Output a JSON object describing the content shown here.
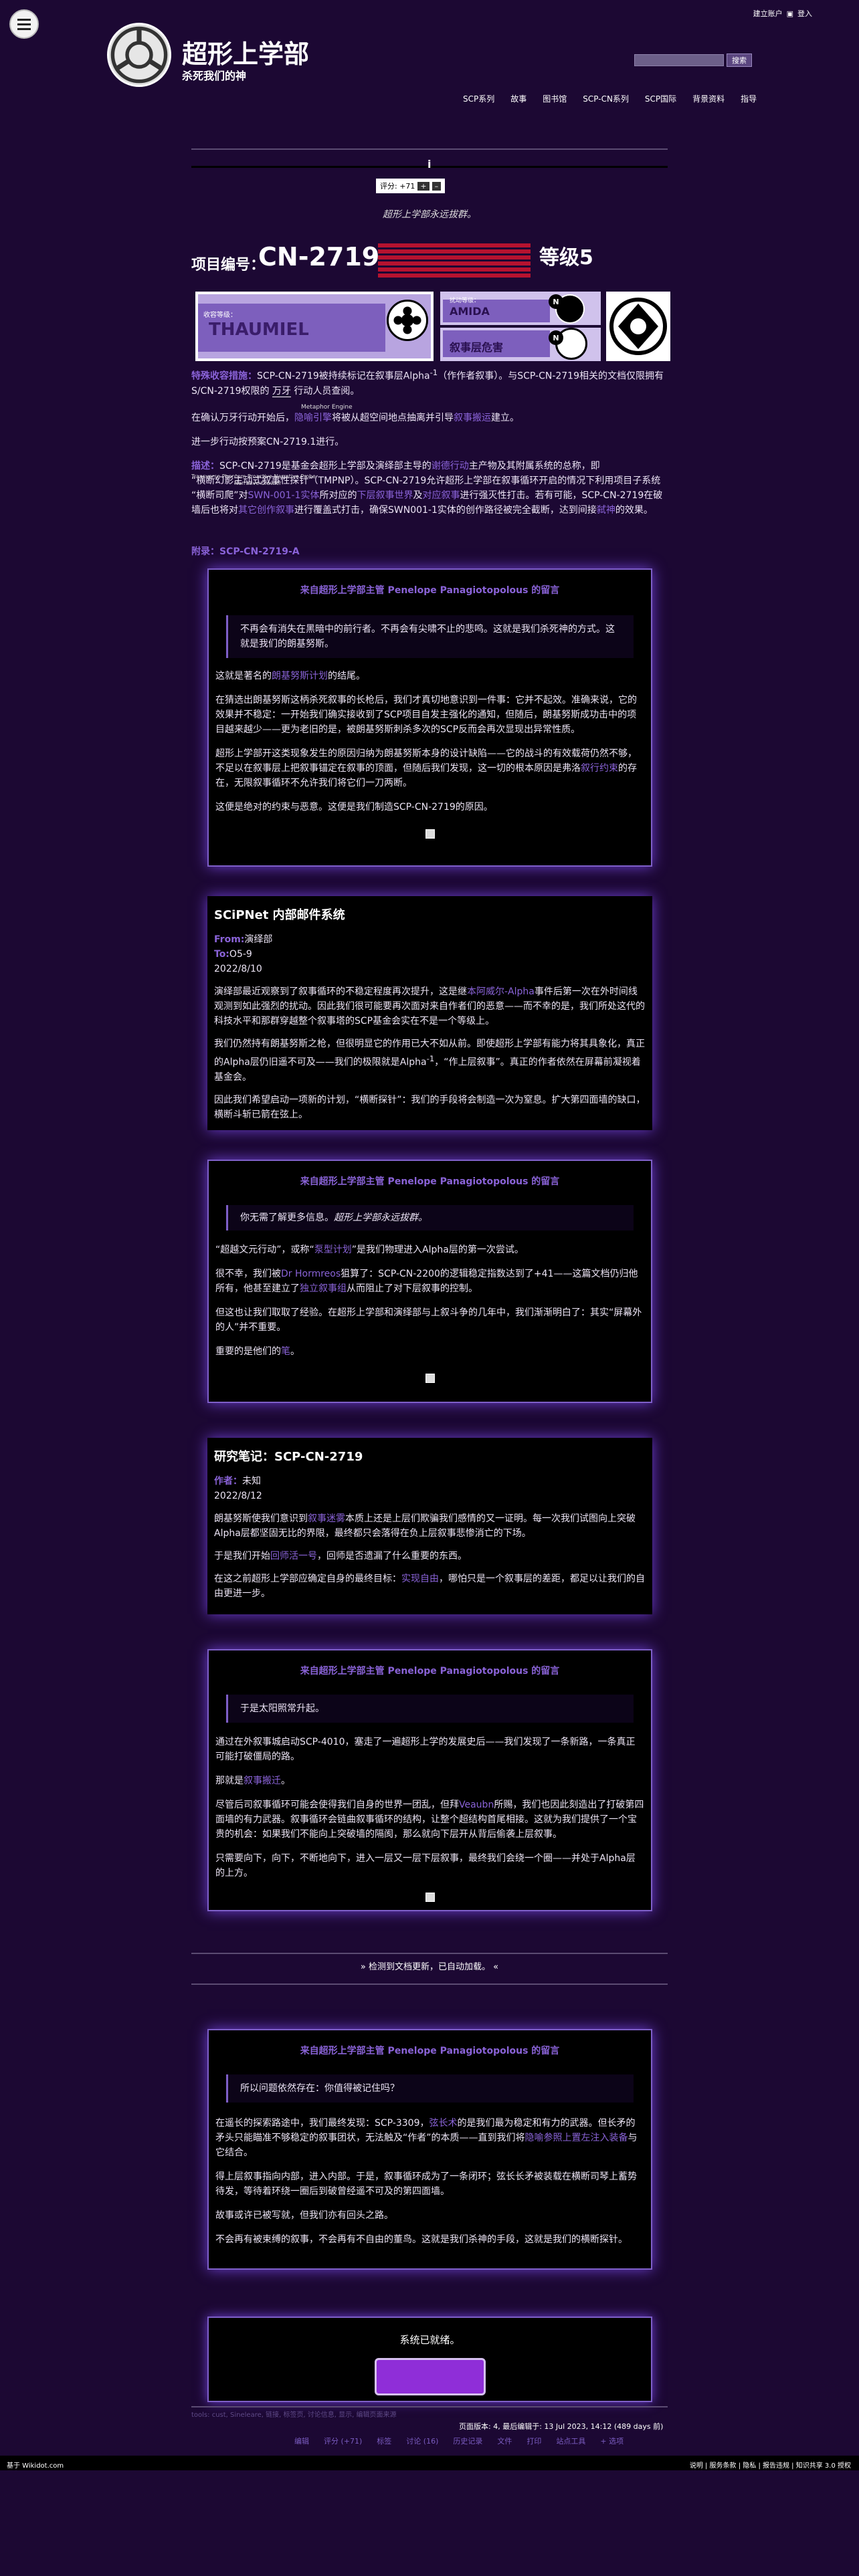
{
  "site": {
    "title": "超形上学部",
    "subtitle": "杀死我们的神",
    "account_create": "建立账户",
    "account_login": "登入",
    "search_button": "搜索"
  },
  "nav": [
    "SCP系列",
    "故事",
    "图书馆",
    "SCP-CN系列",
    "SCP国际",
    "背景资料",
    "指导"
  ],
  "rating": {
    "label": "评分: +71",
    "plus": "+",
    "minus": "–"
  },
  "motto": "超形上学部永远拔群。",
  "item": {
    "label": "项目编号：",
    "number": "CN-2719",
    "clearance": "等级5"
  },
  "classes": {
    "containment_label": "收容等级：",
    "containment": "THAUMIEL",
    "disruption_label": "扰动等级：",
    "disruption": "AMIDA",
    "risk": "叙事层危害",
    "badge": "N"
  },
  "paras": {
    "special_label": "特殊收容措施：",
    "special": "SCP-CN-2719被持续标记在叙事层Alpha",
    "special_sup": "-1",
    "special_2": "（作作者叙事）。与SCP-CN-2719相关的文档仅限拥有S/CN-2719权限的 ",
    "special_ruby": "万牙",
    "special_3": " 行动人员查阅。",
    "p2_a": "在确认万牙行动开始后，",
    "p2_ruby_top": "Metaphor Engine",
    "p2_link": "隐喻引擎",
    "p2_b": "将被从超空间地点抽离并引导",
    "p2_link2": "叙事搬运",
    "p2_c": "建立。",
    "p3": "进一步行动按预案CN-2719.1进行。",
    "desc_label": "描述：",
    "desc_a": "SCP-CN-2719是基金会超形上学部及演绎部主导的",
    "desc_link1": "谢德行动",
    "desc_b": "主产物及其附属系统的总称，即",
    "desc_ruby1_top": "Transverse Phantom Proactive Narrative Probe",
    "desc_ruby1": "“横断幻影主动式叙事性探针”",
    "desc_c": "（TMPNP）。SCP-CN-2719允许超形上学部在叙事循环开启的情况下利用项目子系统",
    "desc_ruby2_top": "Narrative Crawler",
    "desc_ruby2": "“横断司爬”",
    "desc_d": "对",
    "desc_link2": "SWN-001-1实体",
    "desc_e": "所对应的",
    "desc_link3": "下层叙事世界",
    "desc_f": "及",
    "desc_link4": "对应叙事",
    "desc_g": "进行强灭性打击。若有可能，SCP-CN-2719在破墙后也将对",
    "desc_link5": "其它创作叙事",
    "desc_h": "进行覆盖式打击，确保SWN001-1实体的创作路径被完全截断，达到间接",
    "desc_link6": "弑神",
    "desc_i": "的效果。",
    "appendix_label": "附录：",
    "appendix": "SCP-CN-2719-A"
  },
  "boxes": {
    "head": "来自超形上学部主管 Penelope Panagiotopolous 的留言",
    "b1": {
      "quote": "不再会有消失在黑暗中的前行者。不再会有尖啸不止的悲鸣。这就是我们杀死神的方式。这就是我们的朗基努斯。",
      "p1_a": "这就是著名的",
      "p1_link": "朗基努斯计划",
      "p1_b": "的结尾。",
      "p2": "在猜选出朗基努斯这柄杀死叙事的长枪后，我们才真切地意识到一件事：它并不起效。准确来说，它的效果并不稳定：一开始我们确实接收到了SCP项目自发主强化的通知，但随后，朗基努斯成功击中的项目越来越少——更为老旧的是，被朗基努斯刺杀多次的SCP反而会再次显现出异常性质。",
      "p3_a": "超形上学部开这类现象发生的原因归纳为朗基努斯本身的设计缺陷——它的战斗的有效载荷仍然不够，不足以在叙事层上把叙事锚定在叙事的顶面，但随后我们发现，这一切的根本原因是弗洛",
      "p3_link": "叙行约束",
      "p3_b": "的存在，无限叙事循环不允许我们将它们一刀两断。",
      "p4": "这便是绝对的约束与恶意。这便是我们制造SCP-CN-2719的原因。"
    },
    "mail": {
      "title": "SCiPNet 内部邮件系统",
      "from_label": "From:",
      "from": "演绎部",
      "to_label": "To:",
      "to": "O5-9",
      "date": "2022/8/10",
      "p1_a": "演绎部最近观察到了叙事循环的不稳定程度再次提升，这是继",
      "p1_link": "本阿威尔-Alpha",
      "p1_b": "事件后第一次在外时间线观测到如此强烈的扰动。因此我们很可能要再次面对来自作者们的恶意——而不幸的是，我们所处这代的科技水平和那群穿越整个叙事塔的SCP基金会实在不是一个等级上。",
      "p2": "我们仍然持有朗基努斯之枪，但很明显它的作用已大不如从前。即使超形上学部有能力将其具象化，真正的Alpha层仍旧遥不可及——我们的极限就是Alpha",
      "p2_sup": "-1",
      "p2_b": "，“作上层叙事”。真正的作者依然在屏幕前凝视着基金会。",
      "p3": "因此我们希望启动一项新的计划，“横断探针”：我们的手段将会制造一次为窒息。扩大第四面墙的缺口，横断斗斩已箭在弦上。"
    },
    "b2": {
      "quote_a": "你无需了解更多信息。",
      "quote_b": "超形上学部永远拔群。",
      "p1_a": "“超越文元行动”，或称“",
      "p1_link": "泵型计划",
      "p1_b": "”是我们物理进入Alpha层的第一次尝试。",
      "p2_a": "很不幸，我们被",
      "p2_link1": "Dr Hormreos",
      "p2_b": "狙算了：SCP-CN-2200的逻辑稳定指数达到了+41——这篇文档仍归他所有，他甚至建立了",
      "p2_link2": "独立叙事组",
      "p2_c": "从而阻止了对下层叙事的控制。",
      "p3_a": "但这也让我们取取了经验。在超形上学部和演绎部与上叙斗争的几年中，我们渐渐明白了：其实“屏幕外的人”并不重要。",
      "p4_a": "重要的是他们的",
      "p4_link": "笔",
      "p4_b": "。"
    },
    "note": {
      "title": "研究笔记：SCP-CN-2719",
      "author_label": "作者：",
      "author": "未知",
      "date": "2022/8/12",
      "p1_a": "朗基努斯使我们意识到",
      "p1_link": "叙事迷雾",
      "p1_b": "本质上还是上层们欺骗我们感情的又一证明。每一次我们试图向上突破Alpha层都坚固无比的界限，最终都只会落得在负上层叙事悲惨消亡的下场。",
      "p2_a": "于是我们开始",
      "p2_link": "回师活一号",
      "p2_b": "，回师是否遗漏了什么重要的东西。",
      "p3_a": "在这之前超形上学部应确定自身的最终目标：",
      "p3_link": "实现自由",
      "p3_b": "，哪怕只是一个叙事层的差距，都足以让我们的自由更进一步。"
    },
    "b3": {
      "quote": "于是太阳照常升起。",
      "p1": "通过在外叙事城启动SCP-4010，塞走了一遍超形上学的发展史后——我们发现了一条新路，一条真正可能打破僵局的路。",
      "p2_a": "那就是",
      "p2_link": "叙事搬迁",
      "p2_b": "。",
      "p3_a": "尽管后司叙事循环可能会使得我们自身的世界一团乱，但拜",
      "p3_link": "Veaubn",
      "p3_b": "所赐，我们也因此刻造出了打破第四面墙的有力武器。叙事循环会链曲叙事循环的结构，让整个超结构首尾相接。这就为我们提供了一个宝贵的机会：如果我们不能向上突破墙的隔阂，那么就向下层开从背后偷袭上层叙事。",
      "p4": "只需要向下，向下，不断地向下，进入一层又一层下层叙事，最终我们会绕一个圈——并处于Alpha层的上方。"
    },
    "b4": {
      "quote": "所以问题依然存在：你值得被记住吗？",
      "p1_a": "在遥长的探索路途中，我们最终发现：SCP-3309，",
      "p1_link1": "弦长术",
      "p1_b": "的是我们最为稳定和有力的武器。但长矛的矛头只能瞄准不够稳定的叙事团状，无法触及“作者”的本质——直到我们将",
      "p1_link2": "隐喻参照上置左注入装备",
      "p1_c": "与它结合。",
      "p2": "得上层叙事指向内部，进入内部。于是，叙事循环成为了一条闭环；弦长长矛被装载在横断司琴上蓄势待发，等待着环绕一圈后到破曾经遥不可及的第四面墙。",
      "p3": "故事或许已被写就，但我们亦有回头之路。",
      "p4": "不会再有被束缚的叙事，不会再有不自由的董鸟。这就是我们杀神的手段，这就是我们的横断探针。"
    }
  },
  "update_line": "» 检测到文档更新，已自动加载。 «",
  "final": {
    "text": "系统已就绪。"
  },
  "footer": {
    "page_info": "页面版本: 4, 最后编辑于: 13 Jul 2023, 14:12 (489 days 前)",
    "links": "tools: cust, Sineleare, 链接, 标签页, 讨论信息, 显示, 编辑页面来源",
    "nav": [
      "编辑",
      "评分 (+71)",
      "标签",
      "讨论 (16)",
      "历史记录",
      "文件",
      "打印",
      "站点工具",
      "+ 选项"
    ],
    "left": "基于 Wikidot.com",
    "right": "说明 | 服务条款 | 隐私 | 报告违规 | 知识共享 3.0 授权"
  },
  "colors": {
    "bg": "#1c0833",
    "accent": "#8a63d8",
    "stripes": "#b6122f",
    "button": "#8f2ed8"
  }
}
